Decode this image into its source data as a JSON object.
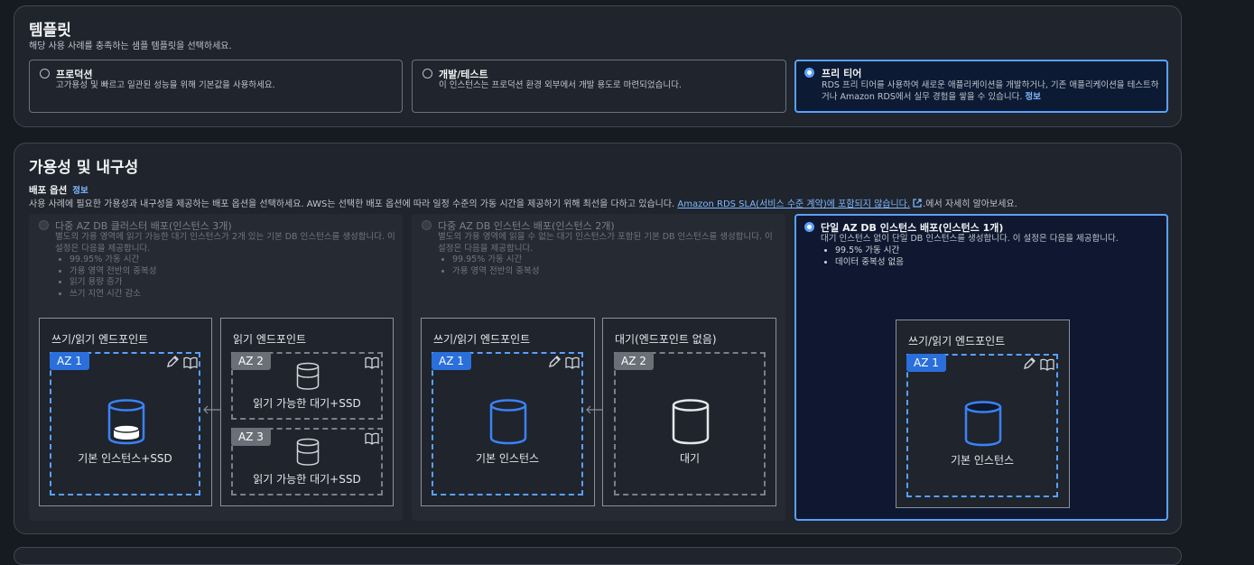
{
  "template": {
    "title": "템플릿",
    "desc": "해당 사용 사례를 충족하는 샘플 템플릿을 선택하세요.",
    "options": [
      {
        "title": "프로덕션",
        "desc": "고가용성 및 빠르고 일관된 성능을 위해 기본값을 사용하세요."
      },
      {
        "title": "개발/테스트",
        "desc": "이 인스턴스는 프로덕션 환경 외부에서 개발 용도로 마련되었습니다."
      },
      {
        "title": "프리 티어",
        "desc": "RDS 프리 티어를 사용하여 새로운 애플리케이션을 개발하거나, 기존 애플리케이션을 테스트하거나 Amazon RDS에서 실무 경험을 쌓을 수 있습니다.",
        "link": "정보"
      }
    ],
    "selected": "프리 티어"
  },
  "availability": {
    "title": "가용성 및 내구성",
    "deploy_label": "배포 옵션",
    "info": "정보",
    "desc_prefix": "사용 사례에 필요한 가용성과 내구성을 제공하는 배포 옵션을 선택하세요. AWS는 선택한 배포 옵션에 따라 일정 수준의 가동 시간을 제공하기 위해 최선을 다하고 있습니다.",
    "desc_link": "Amazon RDS SLA(서비스 수준 계약)에 포함되지 않습니다.",
    "desc_suffix": ".에서 자세히 알아보세요.",
    "options": [
      {
        "title": "다중 AZ DB 클러스터 배포(인스턴스 3개)",
        "desc": "별도의 가용 영역에 읽기 가능한 대기 인스턴스가 2개 있는 기본 DB 인스턴스를 생성합니다. 이 설정은 다음을 제공합니다.",
        "bullets": [
          "99.95% 가동 시간",
          "가용 영역 전반의 중복성",
          "읽기 용량 증가",
          "쓰기 지연 시간 감소"
        ],
        "enabled": false,
        "diagram": {
          "rw_title": "쓰기/읽기 엔드포인트",
          "rw_az": "AZ 1",
          "rw_caption": "기본 인스턴스+SSD",
          "r_title": "읽기 엔드포인트",
          "r_zones": [
            {
              "az": "AZ 2",
              "caption": "읽기 가능한 대기+SSD"
            },
            {
              "az": "AZ 3",
              "caption": "읽기 가능한 대기+SSD"
            }
          ]
        }
      },
      {
        "title": "다중 AZ DB 인스턴스 배포(인스턴스 2개)",
        "desc": "별도의 가용 영역에 읽을 수 없는 대기 인스턴스가 포함된 기본 DB 인스턴스를 생성합니다. 이 설정은 다음을 제공합니다.",
        "bullets": [
          "99.95% 가동 시간",
          "가용 영역 전반의 중복성"
        ],
        "enabled": false,
        "diagram": {
          "rw_title": "쓰기/읽기 엔드포인트",
          "rw_az": "AZ 1",
          "rw_caption": "기본 인스턴스",
          "s_title": "대기(엔드포인트 없음)",
          "s_az": "AZ 2",
          "s_caption": "대기"
        }
      },
      {
        "title": "단일 AZ DB 인스턴스 배포(인스턴스 1개)",
        "desc": "대기 인스턴스 없이 단일 DB 인스턴스를 생성합니다. 이 설정은 다음을 제공합니다.",
        "bullets": [
          "99.5% 가동 시간",
          "데이터 중복성 없음"
        ],
        "enabled": true,
        "diagram": {
          "rw_title": "쓰기/읽기 엔드포인트",
          "rw_az": "AZ 1",
          "rw_caption": "기본 인스턴스"
        }
      }
    ],
    "selected": "단일 AZ DB 인스턴스 배포(인스턴스 1개)"
  },
  "colors": {
    "accent": "#5aa0ff",
    "az_badge": "#2a6fdb",
    "link": "#7fb8ff"
  },
  "icons": [
    "radio-icon",
    "database-icon",
    "pencil-icon",
    "book-icon",
    "external-link-icon",
    "double-arrow-icon"
  ]
}
